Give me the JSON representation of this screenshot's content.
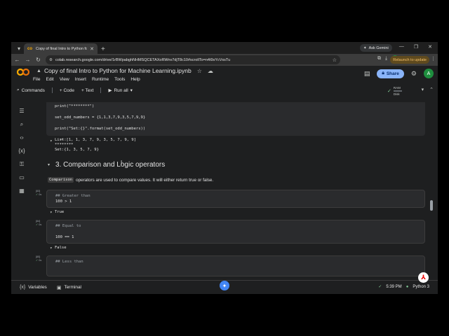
{
  "browser": {
    "tab_title": "Copy of final Intro to Python fo",
    "ask_gemini": "Ask Gemini",
    "url": "colab.research.google.com/drive/1rBWpabghNHMSQCETAXoRWnv7djT8c10#scrollTo=n4t9sYcVxsTu",
    "account_initial": "A",
    "relaunch_label": "Relaunch to update"
  },
  "colab": {
    "title": "Copy of final  Intro to Python for Machine Learning.ipynb",
    "menu": [
      "File",
      "Edit",
      "View",
      "Insert",
      "Runtime",
      "Tools",
      "Help"
    ],
    "share_label": "Share",
    "account_initial": "A",
    "toolbar": {
      "commands": "Commands",
      "code": "+ Code",
      "text": "+ Text",
      "run_all": "Run all"
    },
    "ram_label": "RAM",
    "disk_label": "Disk"
  },
  "notebook": {
    "cell1": {
      "line1": "print(\"********\")",
      "line2": "set_odd_numbers = {1,1,3,7,9,3,5,7,9,9}",
      "line3": "print(\"Set:{}\".format(set_odd_numbers))",
      "out1": "List:[1, 1, 3, 7, 9, 3, 5, 7, 9, 9]",
      "out2": "********",
      "out3": "Set:{1, 3, 5, 7, 9}"
    },
    "heading": "3. Comparison and Logic operators",
    "text_code": "Comparison",
    "text_rest": "operators are used to compare values. It will either return true or false.",
    "cell2": {
      "exec": "[83]",
      "time": "0s",
      "comment": "## Greater than",
      "code": "100 > 1",
      "output": "True"
    },
    "cell3": {
      "exec": "[84]",
      "time": "0s",
      "comment": "## Equal to",
      "code": "100 == 1",
      "output": "False"
    },
    "cell4": {
      "exec": "[85]",
      "time": "0s",
      "comment": "## Less than"
    }
  },
  "status": {
    "variables": "Variables",
    "terminal": "Terminal",
    "time": "5:39 PM",
    "runtime": "Python 3"
  }
}
